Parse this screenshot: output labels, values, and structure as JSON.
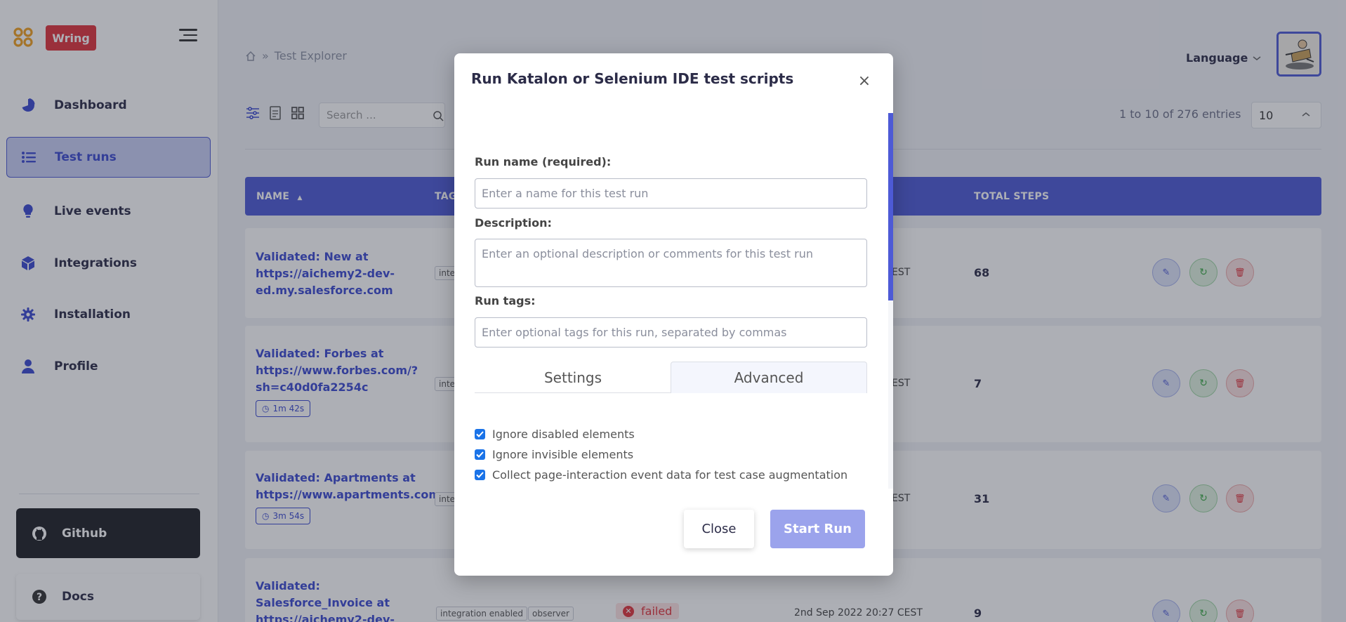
{
  "brand": {
    "badge": "Wring",
    "accent": "#e0323a",
    "primary": "#4d5ad6"
  },
  "sidebar": {
    "items": [
      {
        "label": "Dashboard",
        "icon": "pie-chart-icon"
      },
      {
        "label": "Test runs",
        "icon": "list-icon",
        "active": true
      },
      {
        "label": "Live events",
        "icon": "lightbulb-icon"
      },
      {
        "label": "Integrations",
        "icon": "cube-icon"
      },
      {
        "label": "Installation",
        "icon": "gear-icon"
      },
      {
        "label": "Profile",
        "icon": "user-icon"
      }
    ],
    "github": "Github",
    "docs": "Docs"
  },
  "header": {
    "breadcrumb": {
      "sep": "»",
      "current": "Test Explorer"
    },
    "language": "Language"
  },
  "toolbar": {
    "search_placeholder": "Search ...",
    "entries": "1 to 10 of 276 entries",
    "page_size": "10"
  },
  "table": {
    "columns": {
      "name": "NAME",
      "tags": "TAGS",
      "total_steps": "TOTAL STEPS"
    },
    "rows": [
      {
        "name": "Validated: New at https://aichemy2-dev-ed.my.salesforce.com",
        "duration": "",
        "tag1": "inte",
        "date_suffix": "EST",
        "steps": "68"
      },
      {
        "name": "Validated: Forbes at https://www.forbes.com/?sh=c40d0fa2254c",
        "duration": "1m 42s",
        "tag1": "inte",
        "date_suffix": "EST",
        "steps": "7"
      },
      {
        "name": "Validated: Apartments at https://www.apartments.com",
        "duration": "3m 54s",
        "tag1": "inte",
        "date_suffix": "EST",
        "steps": "31"
      },
      {
        "name": "Validated: Salesforce_Invoice at https://aichemy2-dev-",
        "tag1": "integration enabled",
        "tag2": "observer",
        "status": "failed",
        "date": "2nd Sep 2022 20:27 CEST",
        "steps": "9"
      }
    ]
  },
  "modal": {
    "title": "Run Katalon or Selenium IDE test scripts",
    "close_x": "×",
    "run_name_label": "Run name (required):",
    "run_name_placeholder": "Enter a name for this test run",
    "description_label": "Description:",
    "description_placeholder": "Enter an optional description or comments for this test run",
    "tags_label": "Run tags:",
    "tags_placeholder": "Enter optional tags for this run, separated by commas",
    "tabs": {
      "settings": "Settings",
      "advanced": "Advanced"
    },
    "options": [
      "Ignore disabled elements",
      "Ignore invisible elements",
      "Collect page-interaction event data for test case augmentation"
    ],
    "close_button": "Close",
    "start_button": "Start Run"
  }
}
